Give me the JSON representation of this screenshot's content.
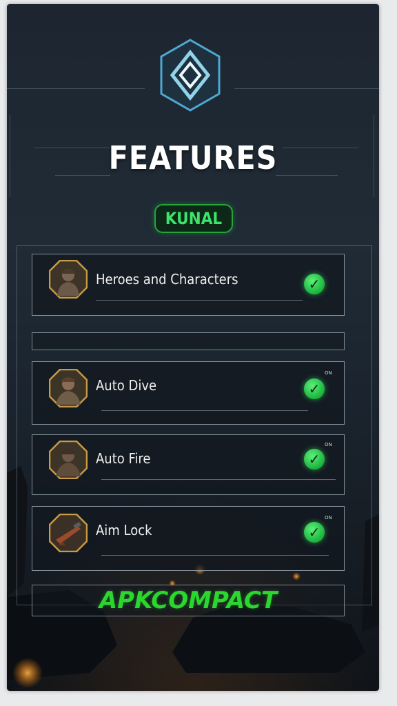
{
  "title": "FEATURES",
  "badge": "KUNAL",
  "features": [
    {
      "label": "Heroes and Characters",
      "enabled": true,
      "icon": "soldier-portrait-icon"
    },
    {
      "label": "Auto Dive",
      "enabled": true,
      "icon": "soldier-portrait-icon",
      "tag": "ON"
    },
    {
      "label": "Auto Fire",
      "enabled": true,
      "icon": "soldier-portrait-icon",
      "tag": "ON"
    },
    {
      "label": "Aim Lock",
      "enabled": true,
      "icon": "weapon-portrait-icon",
      "tag": "ON"
    }
  ],
  "brand": "APKCOMPACT",
  "colors": {
    "accent_green": "#3de36a",
    "check_green": "#19b33c",
    "brand_green": "#2bd62e",
    "frame_glow": "#7fd8ff",
    "portrait_border": "#c99a43"
  }
}
